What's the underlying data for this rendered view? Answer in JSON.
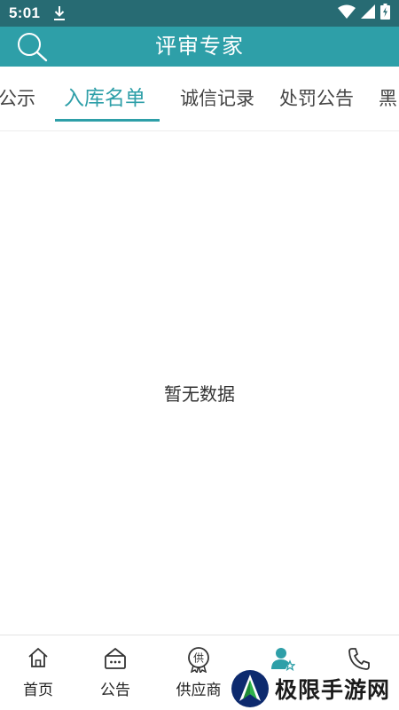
{
  "status_bar": {
    "time": "5:01",
    "icons": [
      "download-icon",
      "wifi-icon",
      "signal-icon",
      "battery-icon"
    ]
  },
  "app_bar": {
    "title": "评审专家",
    "search_icon": "search-icon"
  },
  "tabs": [
    {
      "label": "公示",
      "active": false
    },
    {
      "label": "入库名单",
      "active": true
    },
    {
      "label": "诚信记录",
      "active": false
    },
    {
      "label": "处罚公告",
      "active": false
    },
    {
      "label": "黑",
      "active": false
    }
  ],
  "content": {
    "empty_message": "暂无数据"
  },
  "bottom_nav": [
    {
      "label": "首页",
      "icon": "home-icon",
      "active": false
    },
    {
      "label": "公告",
      "icon": "announcement-icon",
      "active": false
    },
    {
      "label": "供应商",
      "icon": "supplier-badge-icon",
      "icon_text": "供",
      "active": false
    },
    {
      "label": "",
      "icon": "expert-user-star-icon",
      "active": true
    },
    {
      "label": "",
      "icon": "phone-icon",
      "active": false
    }
  ],
  "watermark": {
    "text": "极限手游网"
  },
  "colors": {
    "status_bar": "#276b73",
    "primary": "#2e9fa8",
    "text": "#444444"
  }
}
